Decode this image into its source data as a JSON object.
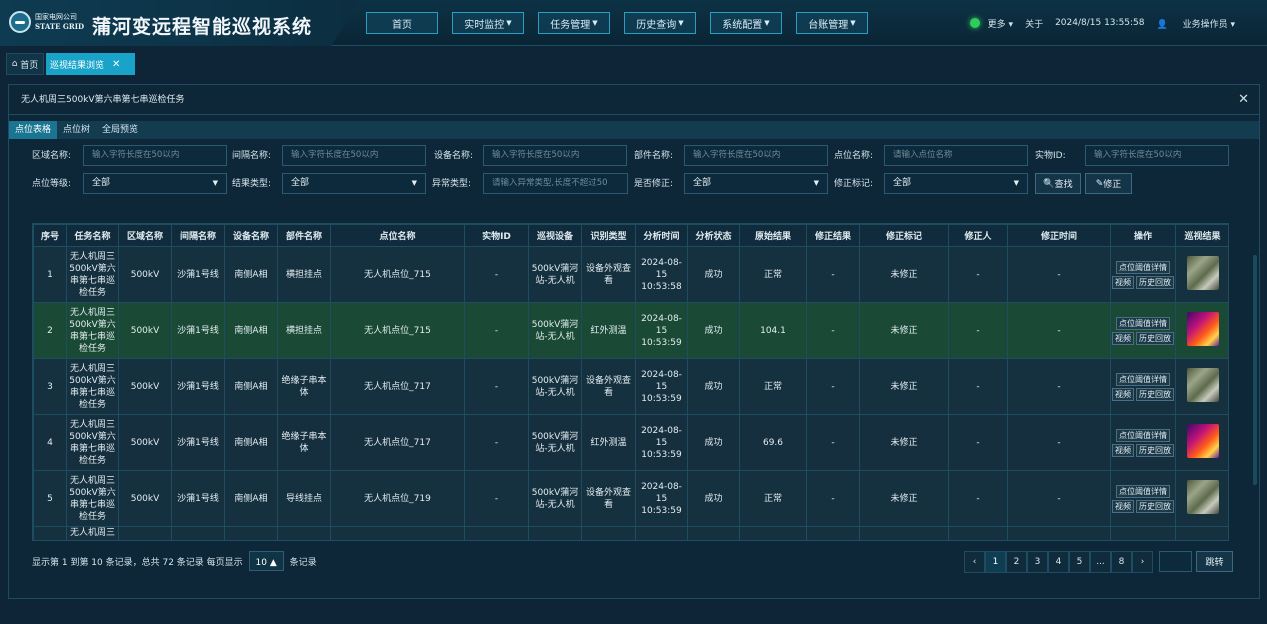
{
  "header": {
    "logo_cn": "国家电网公司",
    "logo_en": "STATE GRID",
    "system_title": "蒲河变远程智能巡视系统",
    "more": "更多 ▾",
    "about": "关于",
    "datetime": "2024/8/15 13:55:58",
    "user": "业务操作员 ▾"
  },
  "nav": [
    {
      "label": "首页"
    },
    {
      "label": "实时监控"
    },
    {
      "label": "任务管理"
    },
    {
      "label": "历史查询"
    },
    {
      "label": "系统配置"
    },
    {
      "label": "台账管理"
    }
  ],
  "tabs": {
    "home": "首页",
    "active": "巡视结果浏览"
  },
  "panel": {
    "title": "无人机周三500kV第六串第七串巡检任务",
    "subtabs": [
      "点位表格",
      "点位树",
      "全局预览"
    ]
  },
  "filters": {
    "area": {
      "label": "区域名称:",
      "placeholder": "输入字符长度在50以内"
    },
    "bay": {
      "label": "间隔名称:",
      "placeholder": "输入字符长度在50以内"
    },
    "device": {
      "label": "设备名称:",
      "placeholder": "输入字符长度在50以内"
    },
    "part": {
      "label": "部件名称:",
      "placeholder": "输入字符长度在50以内"
    },
    "point": {
      "label": "点位名称:",
      "placeholder": "请输入点位名称"
    },
    "object_id": {
      "label": "实物ID:",
      "placeholder": "输入字符长度在50以内"
    },
    "level": {
      "label": "点位等级:",
      "value": "全部"
    },
    "result_type": {
      "label": "结果类型:",
      "value": "全部"
    },
    "abnormal": {
      "label": "异常类型:",
      "placeholder": "请输入异常类型,长度不超过50"
    },
    "corrected": {
      "label": "是否修正:",
      "value": "全部"
    },
    "mark": {
      "label": "修正标记:",
      "value": "全部"
    },
    "search_btn": "查找",
    "correct_btn": "修正"
  },
  "table": {
    "columns": [
      "序号",
      "任务名称",
      "区域名称",
      "间隔名称",
      "设备名称",
      "部件名称",
      "点位名称",
      "实物ID",
      "巡视设备",
      "识别类型",
      "分析时间",
      "分析状态",
      "原始结果",
      "修正结果",
      "修正标记",
      "修正人",
      "修正时间",
      "操作",
      "巡视结果"
    ],
    "op_detail": "点位阈值详情",
    "op_video": "视频",
    "op_history": "历史回放",
    "rows": [
      {
        "no": "1",
        "task": "无人机周三500kV第六串第七串巡检任务",
        "area": "500kV",
        "bay": "沙蒲1号线",
        "device": "南侧A相",
        "part": "横担挂点",
        "point": "无人机点位_715",
        "object_id": "-",
        "patrol_device": "500kV蒲河站-无人机",
        "recog": "设备外观查看",
        "time": "2024-08-15 10:53:58",
        "status": "成功",
        "raw": "正常",
        "fixed": "-",
        "mark": "未修正",
        "fixer": "-",
        "fix_time": "-",
        "thumb": "visible"
      },
      {
        "no": "2",
        "task": "无人机周三500kV第六串第七串巡检任务",
        "area": "500kV",
        "bay": "沙蒲1号线",
        "device": "南侧A相",
        "part": "横担挂点",
        "point": "无人机点位_715",
        "object_id": "-",
        "patrol_device": "500kV蒲河站-无人机",
        "recog": "红外测温",
        "time": "2024-08-15 10:53:59",
        "status": "成功",
        "raw": "104.1",
        "fixed": "-",
        "mark": "未修正",
        "fixer": "-",
        "fix_time": "-",
        "thumb": "infrared"
      },
      {
        "no": "3",
        "task": "无人机周三500kV第六串第七串巡检任务",
        "area": "500kV",
        "bay": "沙蒲1号线",
        "device": "南侧A相",
        "part": "绝缘子串本体",
        "point": "无人机点位_717",
        "object_id": "-",
        "patrol_device": "500kV蒲河站-无人机",
        "recog": "设备外观查看",
        "time": "2024-08-15 10:53:59",
        "status": "成功",
        "raw": "正常",
        "fixed": "-",
        "mark": "未修正",
        "fixer": "-",
        "fix_time": "-",
        "thumb": "visible"
      },
      {
        "no": "4",
        "task": "无人机周三500kV第六串第七串巡检任务",
        "area": "500kV",
        "bay": "沙蒲1号线",
        "device": "南侧A相",
        "part": "绝缘子串本体",
        "point": "无人机点位_717",
        "object_id": "-",
        "patrol_device": "500kV蒲河站-无人机",
        "recog": "红外测温",
        "time": "2024-08-15 10:53:59",
        "status": "成功",
        "raw": "69.6",
        "fixed": "-",
        "mark": "未修正",
        "fixer": "-",
        "fix_time": "-",
        "thumb": "infrared"
      },
      {
        "no": "5",
        "task": "无人机周三500kV第六串第七串巡检任务",
        "area": "500kV",
        "bay": "沙蒲1号线",
        "device": "南侧A相",
        "part": "导线挂点",
        "point": "无人机点位_719",
        "object_id": "-",
        "patrol_device": "500kV蒲河站-无人机",
        "recog": "设备外观查看",
        "time": "2024-08-15 10:53:59",
        "status": "成功",
        "raw": "正常",
        "fixed": "-",
        "mark": "未修正",
        "fixer": "-",
        "fix_time": "-",
        "thumb": "visible"
      },
      {
        "no": "",
        "task": "无人机周三",
        "area": "",
        "bay": "",
        "device": "",
        "part": "",
        "point": "",
        "object_id": "",
        "patrol_device": "",
        "recog": "",
        "time": "",
        "status": "",
        "raw": "",
        "fixed": "",
        "mark": "",
        "fixer": "",
        "fix_time": "",
        "thumb": "infrared",
        "partial": true
      }
    ],
    "selected_row_index": 1
  },
  "pagination": {
    "info": "显示第 1 到第 10 条记录，总共 72 条记录 每页显示",
    "page_size": "10",
    "suffix": "条记录",
    "pages": [
      "‹",
      "1",
      "2",
      "3",
      "4",
      "5",
      "...",
      "8",
      "›"
    ],
    "current": "1",
    "jump_label": "跳转"
  }
}
